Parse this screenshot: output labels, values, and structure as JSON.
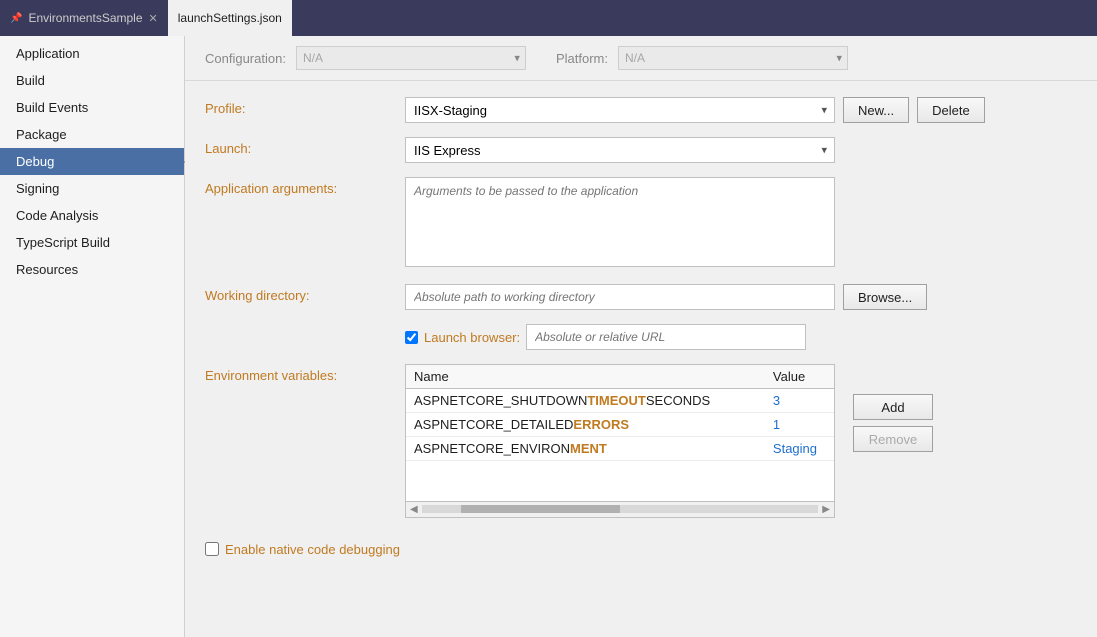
{
  "titlebar": {
    "tabs": [
      {
        "id": "tab-environments",
        "label": "EnvironmentsSample",
        "pin": true,
        "close": true,
        "active": false
      },
      {
        "id": "tab-launch",
        "label": "launchSettings.json",
        "active": true
      }
    ]
  },
  "sidebar": {
    "items": [
      {
        "id": "application",
        "label": "Application",
        "active": false
      },
      {
        "id": "build",
        "label": "Build",
        "active": false
      },
      {
        "id": "build-events",
        "label": "Build Events",
        "active": false
      },
      {
        "id": "package",
        "label": "Package",
        "active": false
      },
      {
        "id": "debug",
        "label": "Debug",
        "active": true
      },
      {
        "id": "signing",
        "label": "Signing",
        "active": false
      },
      {
        "id": "code-analysis",
        "label": "Code Analysis",
        "active": false
      },
      {
        "id": "typescript-build",
        "label": "TypeScript Build",
        "active": false
      },
      {
        "id": "resources",
        "label": "Resources",
        "active": false
      }
    ]
  },
  "configbar": {
    "configuration_label": "Configuration:",
    "configuration_value": "N/A",
    "platform_label": "Platform:",
    "platform_value": "N/A"
  },
  "form": {
    "profile_label": "Profile:",
    "profile_value": "IISX-Staging",
    "profile_options": [
      "IISX-Staging"
    ],
    "new_button": "New...",
    "delete_button": "Delete",
    "launch_label": "Launch:",
    "launch_value": "IIS Express",
    "launch_options": [
      "IIS Express"
    ],
    "app_args_label": "Application arguments:",
    "app_args_placeholder": "Arguments to be passed to the application",
    "working_dir_label": "Working directory:",
    "working_dir_placeholder": "Absolute path to working directory",
    "browse_button": "Browse...",
    "launch_browser_label": "Launch browser:",
    "launch_browser_checked": true,
    "launch_browser_url_placeholder": "Absolute or relative URL",
    "env_vars_label": "Environment variables:",
    "env_table": {
      "col_name": "Name",
      "col_value": "Value",
      "rows": [
        {
          "name": "ASPNETCORE_SHUTDOWNTIMEOUTSECONDS",
          "value": "3"
        },
        {
          "name": "ASPNETCORE_DETAILEDERRORS",
          "value": "1"
        },
        {
          "name": "ASPNETCORE_ENVIRONMENT",
          "value": "Staging"
        }
      ]
    },
    "add_button": "Add",
    "remove_button": "Remove",
    "enable_native_label": "Enable native code debugging",
    "enable_native_checked": false
  },
  "colors": {
    "label_color": "#c07a20",
    "active_sidebar": "#4a6fa5",
    "title_bar_bg": "#3a3a5c",
    "env_value_color": "#1e6fcc"
  }
}
